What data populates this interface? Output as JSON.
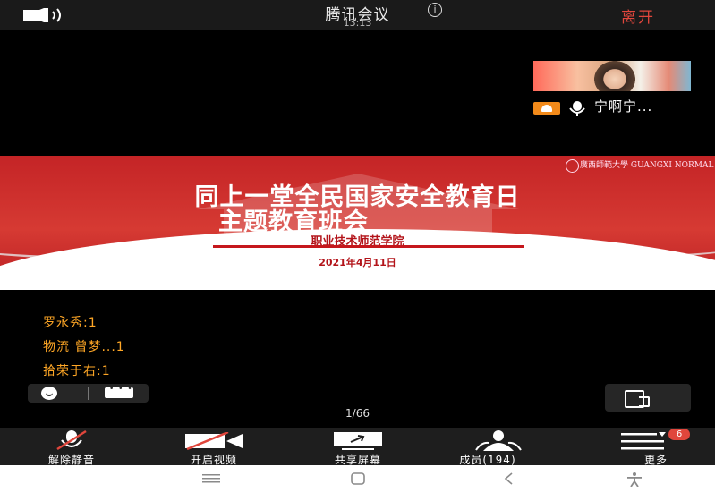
{
  "header": {
    "title": "腾讯会议",
    "time": "13:13",
    "leave_label": "离开"
  },
  "participant": {
    "name": "宁啊宁..."
  },
  "slide": {
    "university": "廣西師範大學 GUANGXI NORMAL UNIVERSITY",
    "title_line1": "同上一堂全民国家安全教育日",
    "title_line2": "主题教育班会",
    "subtitle": "职业技术师范学院",
    "date": "2021年4月11日"
  },
  "chat": {
    "messages": [
      {
        "text": "罗永秀:1"
      },
      {
        "text": "物流 曾梦...1"
      },
      {
        "text": "拾荣于右:1"
      }
    ]
  },
  "pagination": {
    "page": "1/66"
  },
  "toolbar": {
    "items": [
      {
        "label": "解除静音",
        "icon": "mic-muted-icon"
      },
      {
        "label": "开启视频",
        "icon": "video-off-icon"
      },
      {
        "label": "共享屏幕",
        "icon": "share-screen-icon"
      },
      {
        "label": "成员(194)",
        "icon": "members-icon"
      },
      {
        "label": "更多",
        "icon": "more-menu-icon"
      }
    ],
    "more_badge": "6"
  },
  "colors": {
    "accent_red": "#e0463c",
    "chat_orange": "#ffa726",
    "slide_red": "#c42426",
    "host_orange": "#f28a1a"
  }
}
